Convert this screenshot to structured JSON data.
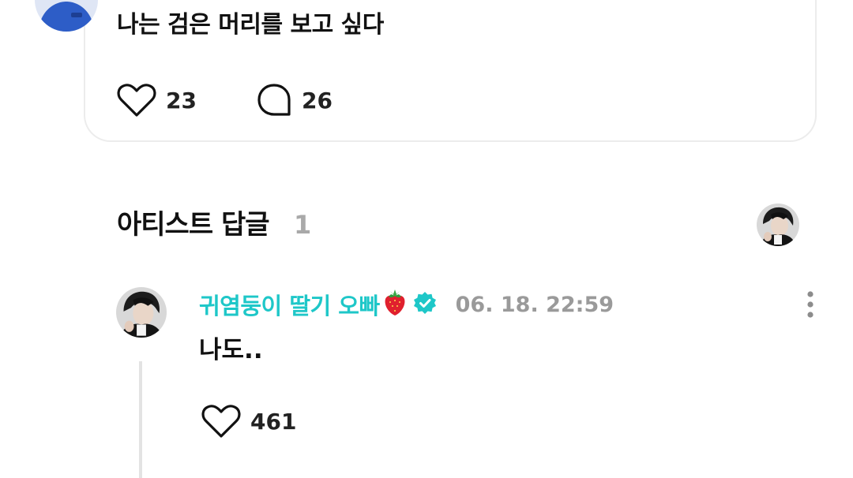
{
  "post": {
    "text": "나는 검은 머리를 보고 싶다",
    "like_count": "23",
    "comment_count": "26"
  },
  "artist_reply_section": {
    "title": "아티스트 답글",
    "count": "1"
  },
  "reply": {
    "author": "귀염둥이 딸기 오빠",
    "author_emoji": "🍓",
    "timestamp": "06. 18. 22:59",
    "text": "나도..",
    "like_count": "461"
  },
  "colors": {
    "author_accent": "#1ec7c8",
    "verified_badge": "#1ec7c8",
    "muted_text": "#9a9a9a",
    "section_count": "#a9a9a9",
    "card_border": "#ececec",
    "thread_line": "#e3e3e3"
  },
  "icons": {
    "like": "heart-outline-icon",
    "comment": "speech-bubble-icon",
    "verified": "verified-badge-icon",
    "more": "vertical-dots-icon"
  }
}
